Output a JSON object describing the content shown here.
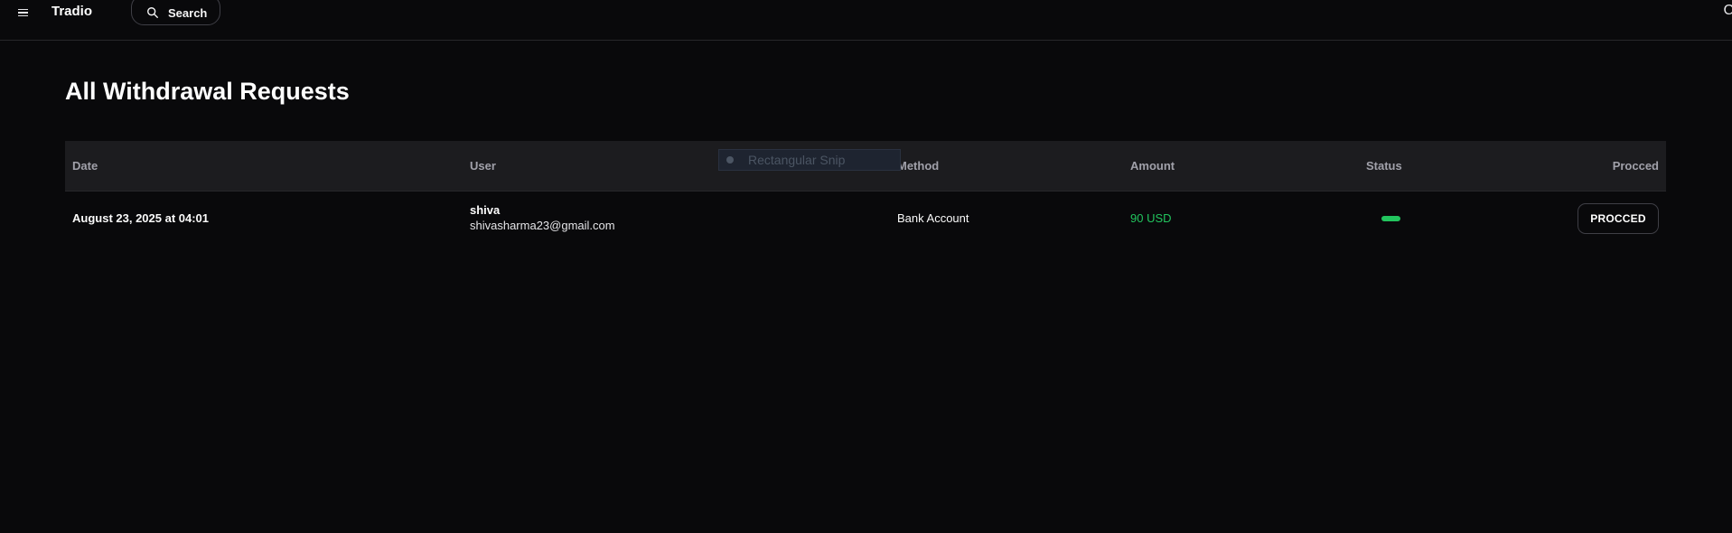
{
  "header": {
    "menu_icon": "hamburger-menu-icon",
    "brand": "Tradio",
    "search_icon": "search-icon",
    "search_label": "Search",
    "corner_text": "C"
  },
  "page": {
    "title": "All Withdrawal Requests"
  },
  "table": {
    "columns": {
      "date": "Date",
      "user": "User",
      "method": "Method",
      "amount": "Amount",
      "status": "Status",
      "proceed": "Procced"
    },
    "rows": [
      {
        "date": "August 23, 2025 at 04:01",
        "user_name": "shiva",
        "user_email": "shivasharma23@gmail.com",
        "method": "Bank Account",
        "amount": "90 USD",
        "status_color": "#22c55e",
        "action_label": "PROCCED"
      }
    ]
  },
  "snip_overlay": {
    "label": "Rectangular Snip"
  },
  "colors": {
    "background": "#09090b",
    "accent_green": "#22c55e",
    "header_row": "#1c1c1f"
  }
}
